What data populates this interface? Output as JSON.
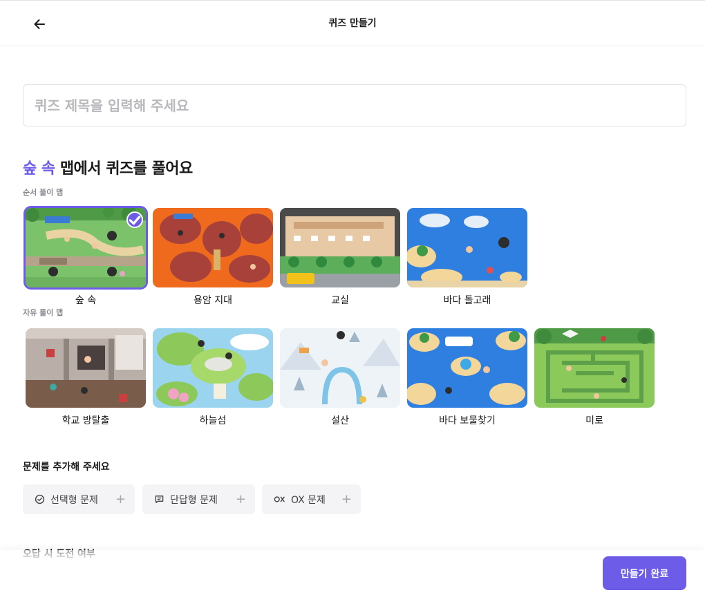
{
  "header": {
    "title": "퀴즈 만들기",
    "back_icon": "arrow-left-icon"
  },
  "quiz_title_input": {
    "placeholder": "퀴즈 제목을 입력해 주세요",
    "value": ""
  },
  "map_section": {
    "selected_map": "숲 속",
    "heading_suffix": "맵에서 퀴즈를 풀어요",
    "accent_color": "#6c5ce7",
    "ordered_label": "순서 풀이 맵",
    "ordered_maps": [
      {
        "name": "숲 속",
        "selected": true
      },
      {
        "name": "용암 지대",
        "selected": false
      },
      {
        "name": "교실",
        "selected": false
      },
      {
        "name": "바다 돌고래",
        "selected": false
      }
    ],
    "free_label": "자유 풀이 맵",
    "free_maps": [
      {
        "name": "학교 방탈출",
        "selected": false
      },
      {
        "name": "하늘섬",
        "selected": false
      },
      {
        "name": "설산",
        "selected": false
      },
      {
        "name": "바다 보물찾기",
        "selected": false
      },
      {
        "name": "미로",
        "selected": false
      }
    ]
  },
  "questions": {
    "heading": "문제를 추가해 주세요",
    "types": [
      {
        "label": "선택형 문제",
        "icon": "check-circle-icon"
      },
      {
        "label": "단답형 문제",
        "icon": "message-square-icon"
      },
      {
        "label": "OX 문제",
        "icon": "ox-icon"
      }
    ],
    "add_icon": "plus-icon"
  },
  "partial_section_heading": "오답 시 도전 여부",
  "footer": {
    "done_label": "만들기 완료",
    "button_color": "#6c5ce7"
  }
}
